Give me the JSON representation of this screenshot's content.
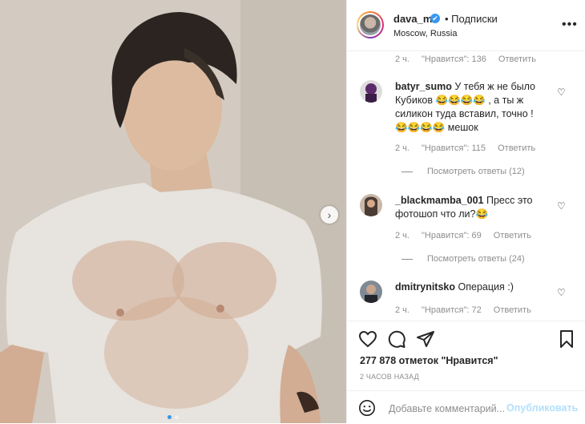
{
  "post": {
    "username": "dava_m",
    "verified_mark": "✔",
    "follow_label": "• Подписки",
    "location": "Moscow, Russia",
    "more_icon": "more-horizontal-icon"
  },
  "media": {
    "next_icon": "chevron-right-icon",
    "dots": 2,
    "active_dot": 0
  },
  "comments": [
    {
      "meta": {
        "time": "2 ч.",
        "likes": "\"Нравится\": 136",
        "reply": "Ответить"
      }
    },
    {
      "username": "batyr_sumo",
      "text_1": "У тебя ж не было",
      "text_2": "Кубиков 😂😂😂😂 , а ты ж",
      "text_3": "силикон туда вставил, точно !",
      "text_4": "😂😂😂😂 мешок",
      "meta": {
        "time": "2 ч.",
        "likes": "\"Нравится\": 115",
        "reply": "Ответить"
      },
      "replies": "Посмотреть ответы (12)"
    },
    {
      "username": "_blackmamba_001",
      "text_1": "Пресс это",
      "text_2": "фотошоп что ли?😂",
      "meta": {
        "time": "2 ч.",
        "likes": "\"Нравится\": 69",
        "reply": "Ответить"
      },
      "replies": "Посмотреть ответы (24)"
    },
    {
      "username": "dmitrynitsko",
      "text_1": "Операция :)",
      "meta": {
        "time": "2 ч.",
        "likes": "\"Нравится\": 72",
        "reply": "Ответить"
      }
    }
  ],
  "actions": {
    "like_icon": "heart-icon",
    "comment_icon": "comment-icon",
    "share_icon": "paper-plane-icon",
    "save_icon": "bookmark-icon",
    "likes_count": "277 878 отметок \"Нравится\"",
    "timestamp": "2 ЧАСОВ НАЗАД"
  },
  "add_comment": {
    "placeholder": "Добавьте комментарий...",
    "publish": "Опубликовать",
    "emoji_icon": "smiley-icon"
  },
  "colors": {
    "accent": "#3897f0",
    "publish_disabled": "#b2dffc",
    "muted": "#8e8e8e"
  }
}
